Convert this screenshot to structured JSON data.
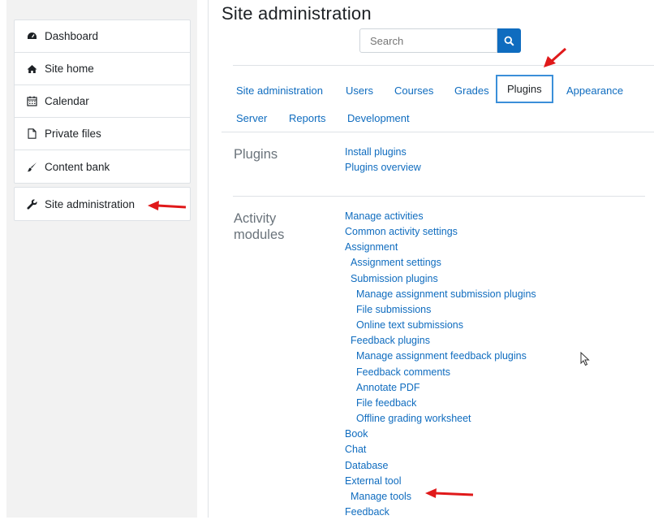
{
  "nav": {
    "items": [
      {
        "label": "Dashboard",
        "icon": "tachometer-icon"
      },
      {
        "label": "Site home",
        "icon": "home-icon"
      },
      {
        "label": "Calendar",
        "icon": "calendar-icon"
      },
      {
        "label": "Private files",
        "icon": "file-icon"
      },
      {
        "label": "Content bank",
        "icon": "paint-brush-icon"
      }
    ],
    "admin_item": {
      "label": "Site administration",
      "icon": "wrench-icon"
    }
  },
  "page": {
    "title": "Site administration"
  },
  "search": {
    "placeholder": "Search",
    "button_icon": "search-icon"
  },
  "tabs": {
    "site_admin": "Site administration",
    "users": "Users",
    "courses": "Courses",
    "grades": "Grades",
    "plugins": "Plugins",
    "appearance": "Appearance",
    "server": "Server",
    "reports": "Reports",
    "development": "Development",
    "active": "Plugins"
  },
  "sections": {
    "plugins": {
      "title": "Plugins",
      "links": [
        "Install plugins",
        "Plugins overview"
      ]
    },
    "activity": {
      "title_line1": "Activity",
      "title_line2": "modules",
      "links": [
        "Manage activities",
        "Common activity settings",
        "Assignment",
        "Assignment settings",
        "Submission plugins",
        "Manage assignment submission plugins",
        "File submissions",
        "Online text submissions",
        "Feedback plugins",
        "Manage assignment feedback plugins",
        "Feedback comments",
        "Annotate PDF",
        "File feedback",
        "Offline grading worksheet",
        "Book",
        "Chat",
        "Database",
        "External tool",
        "Manage tools",
        "Feedback"
      ]
    }
  },
  "colors": {
    "link": "#0f6cbf",
    "accent_border": "#3b8fd9",
    "annotation_arrow": "#e0191a"
  }
}
